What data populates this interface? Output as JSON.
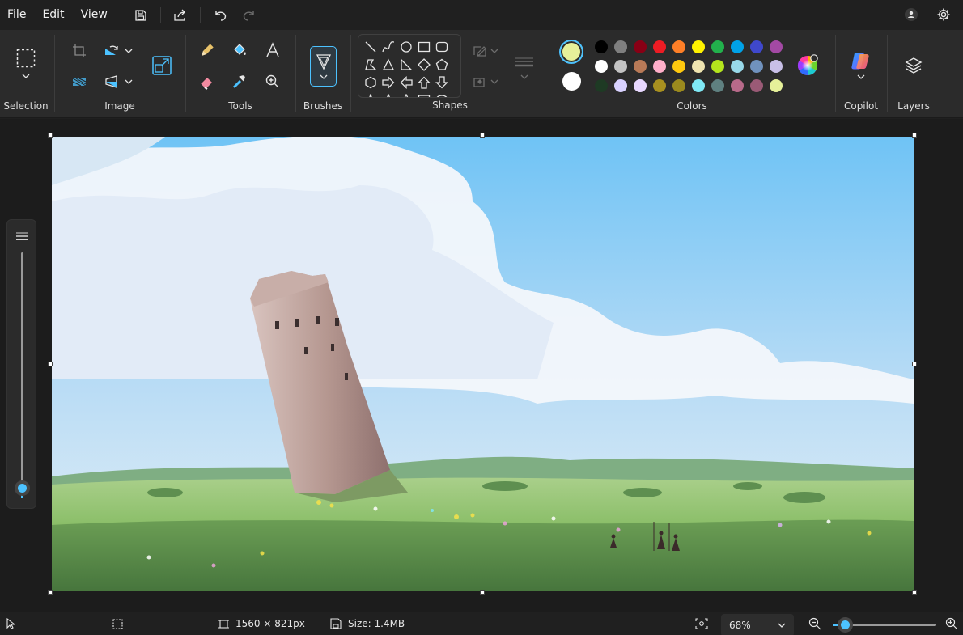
{
  "menu": {
    "file": "File",
    "edit": "Edit",
    "view": "View"
  },
  "ribbon": {
    "selection_label": "Selection",
    "image_label": "Image",
    "tools_label": "Tools",
    "brushes_label": "Brushes",
    "shapes_label": "Shapes",
    "colors_label": "Colors",
    "copilot_label": "Copilot",
    "layers_label": "Layers"
  },
  "colors": {
    "primary": "#e6f19a",
    "secondary": "#ffffff",
    "palette": [
      "#000000",
      "#7f7f7f",
      "#880015",
      "#ed1c24",
      "#ff7f27",
      "#fff200",
      "#22b14c",
      "#00a2e8",
      "#3f48cc",
      "#a349a4",
      "#ffffff",
      "#c3c3c3",
      "#b97a57",
      "#ffaec9",
      "#ffc90e",
      "#efe4b0",
      "#b5e61d",
      "#99d9ea",
      "#7092be",
      "#c8bfe7",
      "#1e3a24",
      "#d9d2ff",
      "#e8d8ff",
      "#a89020",
      "#9b8a1e",
      "#7fe8f5",
      "#5f8080",
      "#b86a8a",
      "#9a5a76",
      "#e6f19a"
    ]
  },
  "status": {
    "dimensions": "1560 × 821px",
    "size": "Size: 1.4MB",
    "zoom": "68%",
    "zoom_fraction": 0.12
  }
}
